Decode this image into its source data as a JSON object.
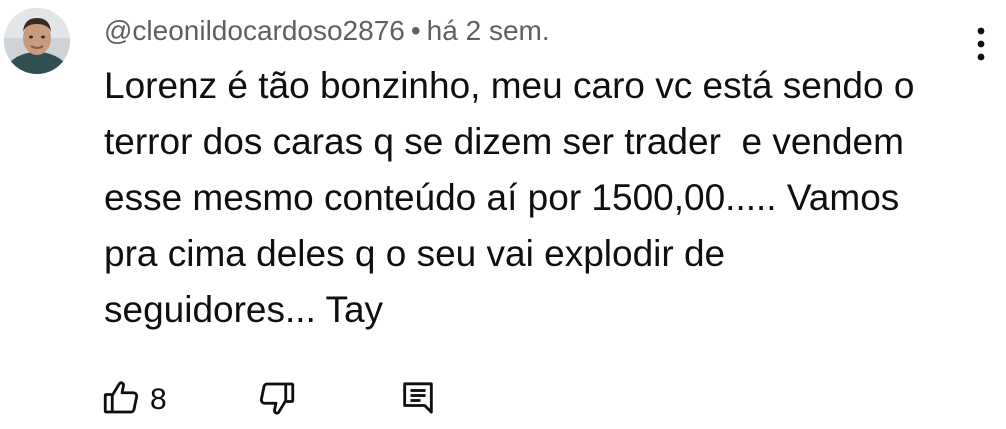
{
  "comment": {
    "author": "@cleonildocardoso2876",
    "separator": "•",
    "timestamp": "há 2 sem.",
    "text": "Lorenz é tão bonzinho, meu caro vc está sendo o\nterror dos caras q se dizem ser trader  e vendem\nesse mesmo conteúdo aí por 1500,00..... Vamos\npra cima deles q o seu vai explodir de\nseguidores... Tay",
    "like_count": "8"
  },
  "icons": {
    "avatar": "avatar",
    "more": "more-vert-icon",
    "like": "thumb-up-icon",
    "dislike": "thumb-down-icon",
    "reply": "comment-reply-icon"
  }
}
